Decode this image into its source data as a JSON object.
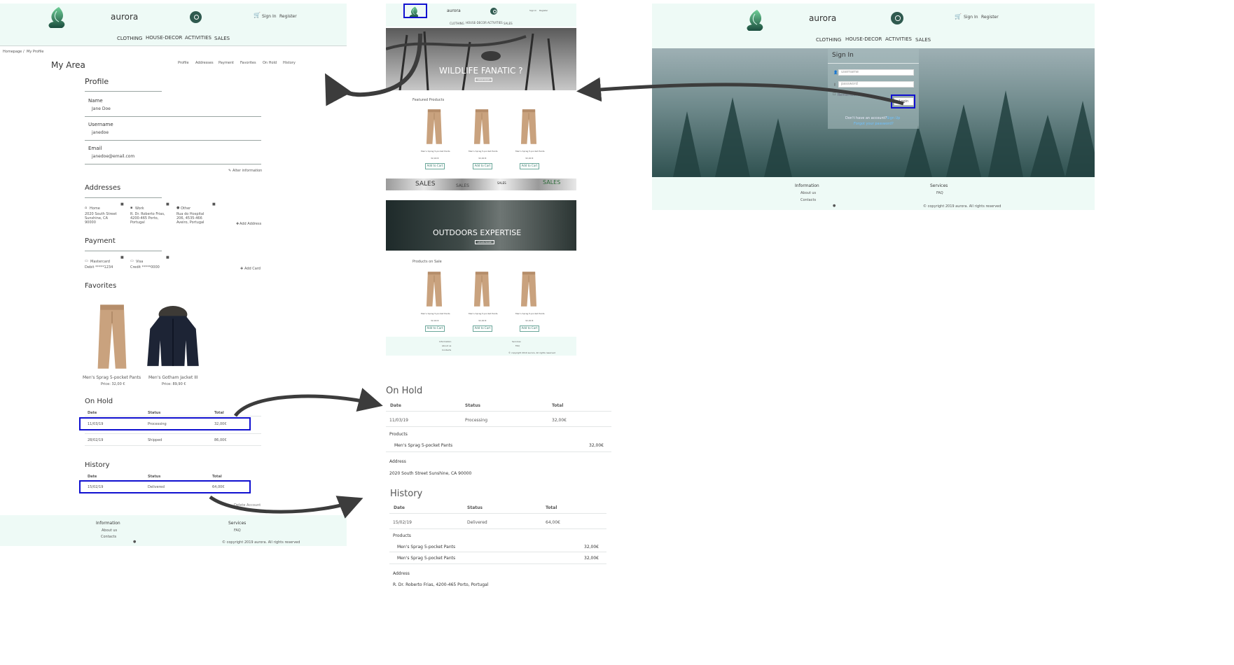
{
  "brand": "aurora",
  "header": {
    "sign_in": "Sign In",
    "register": "Register",
    "nav": [
      "CLOTHING",
      "HOUSE-DECOR",
      "ACTIVITIES",
      "SALES"
    ]
  },
  "breadcrumb": [
    "Homepage",
    "My Profile"
  ],
  "my_area": {
    "title": "My Area",
    "tabs": [
      "Profile",
      "Addresses",
      "Payment",
      "Favorites",
      "On Hold",
      "History"
    ],
    "profile": {
      "title": "Profile",
      "name_label": "Name",
      "name_value": "Jane Doe",
      "username_label": "Username",
      "username_value": "janedoe",
      "email_label": "Email",
      "email_value": "janedoe@email.com",
      "alter": "Alter information"
    },
    "addresses": {
      "title": "Addresses",
      "items": [
        {
          "label": "Home",
          "text": "2020 South Street Sunshine, CA 90000"
        },
        {
          "label": "Work",
          "text": "R. Dr. Roberto Frias, 4200-465 Porto, Portugal"
        },
        {
          "label": "Other",
          "text": "Rua do Hospital 206, 4535-466 Aveiro, Portugal"
        }
      ],
      "add": "Add Address"
    },
    "payment": {
      "title": "Payment",
      "items": [
        {
          "label": "Mastercard",
          "text": "Debit *****1234"
        },
        {
          "label": "Visa",
          "text": "Credit *****0000"
        }
      ],
      "add": "Add Card"
    },
    "favorites": {
      "title": "Favorites",
      "items": [
        {
          "name": "Men's Sprag 5-pocket Pants",
          "price": "Price: 32,00 €"
        },
        {
          "name": "Men's Gotham Jacket III",
          "price": "Price: 89,90 €"
        }
      ]
    },
    "on_hold": {
      "title": "On Hold",
      "headers": [
        "Date",
        "Status",
        "Total"
      ],
      "rows": [
        {
          "date": "11/03/19",
          "status": "Processing",
          "total": "32,00€"
        },
        {
          "date": "28/02/19",
          "status": "Shipped",
          "total": "86,00€"
        }
      ]
    },
    "history": {
      "title": "History",
      "headers": [
        "Date",
        "Status",
        "Total"
      ],
      "rows": [
        {
          "date": "15/02/19",
          "status": "Delivered",
          "total": "64,00€"
        }
      ]
    },
    "delete_account": "Delete Account"
  },
  "footer": {
    "information": "Information",
    "about": "About us",
    "contacts": "Contacts",
    "services": "Services",
    "faq": "FAQ",
    "copyright": "© copyright 2019 aurora. All rights reserved"
  },
  "home": {
    "hero1": "WILDLIFE FANATIC ?",
    "hero1_btn": "SHOP NOW",
    "featured": "Featured Products",
    "product_name": "Men's Sprag 5-pocket Pants",
    "product_price": "32,00 €",
    "add_to_cart": "Add to Cart",
    "sales_banner": [
      "SALES",
      "SALES",
      "SALES",
      "SALES"
    ],
    "hero2": "OUTDOORS EXPERTISE",
    "hero2_btn": "LEARN MORE",
    "on_sale": "Products on Sale"
  },
  "signin": {
    "title": "Sign In",
    "username_placeholder": "username",
    "password_placeholder": "password",
    "remember": "Remember me",
    "login": "Login",
    "no_account": "Don't have an account?",
    "sign_up": "Sign Up",
    "forgot": "Forgot your password?"
  },
  "detail": {
    "on_hold_title": "On Hold",
    "headers": [
      "Date",
      "Status",
      "Total"
    ],
    "on_hold_row": {
      "date": "11/03/19",
      "status": "Processing",
      "total": "32,00€"
    },
    "products_label": "Products",
    "on_hold_products": [
      {
        "name": "Men's Sprag 5-pocket Pants",
        "price": "32,00€"
      }
    ],
    "address_label": "Address",
    "on_hold_address": "2020 South Street Sunshine, CA 90000",
    "history_title": "History",
    "history_row": {
      "date": "15/02/19",
      "status": "Delivered",
      "total": "64,00€"
    },
    "history_products": [
      {
        "name": "Men's Sprag 5-pocket Pants",
        "price": "32,00€"
      },
      {
        "name": "Men's Sprag 5-pocket Pants",
        "price": "32,00€"
      }
    ],
    "history_address": "R. Dr. Roberto Frias, 4200-465 Porto, Portugal"
  },
  "colors": {
    "accent": "#2f5a4f",
    "mint": "#eefaf6",
    "highlight": "#1010d0"
  }
}
